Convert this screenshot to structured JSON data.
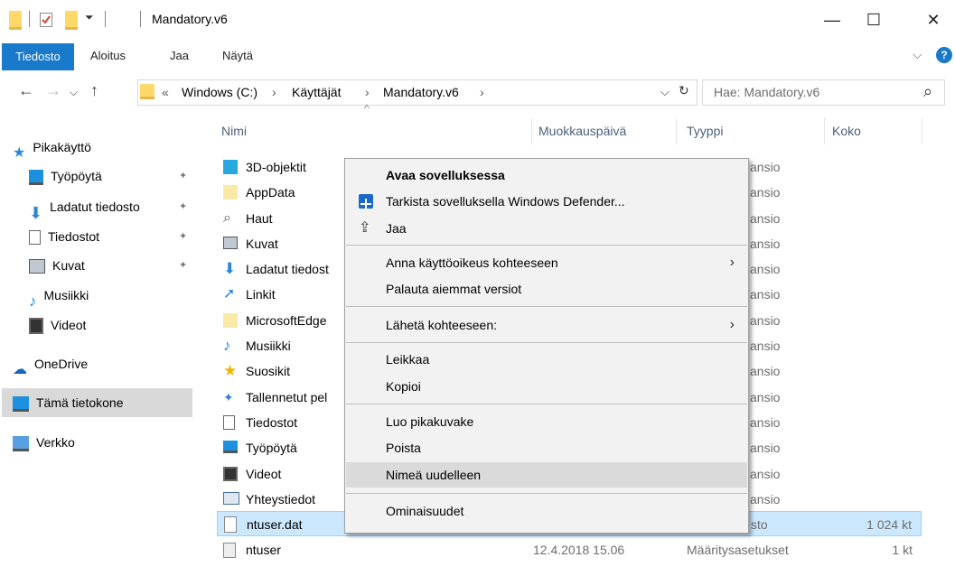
{
  "window": {
    "title": "Mandatory.v6",
    "minimize_icon": "—",
    "maximize_icon": "☐",
    "close_icon": "✕"
  },
  "ribbon": {
    "file_tab": "Tiedosto",
    "tabs": [
      "Aloitus",
      "Jaa",
      "Näytä"
    ],
    "collapse_icon": "⌵",
    "help_icon": "?"
  },
  "address": {
    "overflow": "«",
    "crumbs": [
      "Windows (C:)",
      "Käyttäjät",
      "Mandatory.v6"
    ],
    "separator": "›",
    "dropdown": "⌵",
    "refresh": "↻"
  },
  "search": {
    "placeholder": "Hae: Mandatory.v6",
    "icon": "⌕"
  },
  "sidebar": {
    "quick_access": "Pikakäyttö",
    "items": [
      "Työpöytä",
      "Ladatut tiedosto",
      "Tiedostot",
      "Kuvat",
      "Musiikki",
      "Videot"
    ],
    "onedrive": "OneDrive",
    "this_pc": "Tämä tietokone",
    "network": "Verkko",
    "pin": "📌"
  },
  "columns": {
    "name": "Nimi",
    "date": "Muokkauspäivä",
    "type": "Tyyppi",
    "size": "Koko"
  },
  "files": [
    {
      "name": "3D-objektit",
      "type": "ansio"
    },
    {
      "name": "AppData",
      "type": "ansio"
    },
    {
      "name": "Haut",
      "type": "ansio"
    },
    {
      "name": "Kuvat",
      "type": "ansio"
    },
    {
      "name": "Ladatut tiedost",
      "type": "ansio"
    },
    {
      "name": "Linkit",
      "type": "ansio"
    },
    {
      "name": "MicrosoftEdge",
      "type": "ansio"
    },
    {
      "name": "Musiikki",
      "type": "ansio"
    },
    {
      "name": "Suosikit",
      "type": "ansio"
    },
    {
      "name": "Tallennetut pel",
      "type": "ansio"
    },
    {
      "name": "Tiedostot",
      "type": "ansio"
    },
    {
      "name": "Työpöytä",
      "type": "ansio"
    },
    {
      "name": "Videot",
      "type": "ansio"
    },
    {
      "name": "Yhteystiedot",
      "type": "ansio"
    }
  ],
  "selected_file": {
    "name": "ntuser.dat",
    "type": "sto",
    "size": "1 024 kt"
  },
  "last_file": {
    "name": "ntuser",
    "date": "12.4.2018 15.06",
    "type": "Määritysasetukset",
    "size": "1 kt"
  },
  "context_menu": {
    "open_with": "Avaa sovelluksessa",
    "defender": "Tarkista sovelluksella Windows Defender...",
    "share": "Jaa",
    "give_access": "Anna käyttöoikeus kohteeseen",
    "restore": "Palauta aiemmat versiot",
    "send_to": "Lähetä kohteeseen:",
    "cut": "Leikkaa",
    "copy": "Kopioi",
    "shortcut": "Luo pikakuvake",
    "delete": "Poista",
    "rename": "Nimeä uudelleen",
    "properties": "Ominaisuudet",
    "chevron": "›"
  },
  "colors": {
    "accent": "#1979ca",
    "folder": "#ffd86a",
    "selected_row": "#cce8ff",
    "hover_item": "#dadada"
  }
}
